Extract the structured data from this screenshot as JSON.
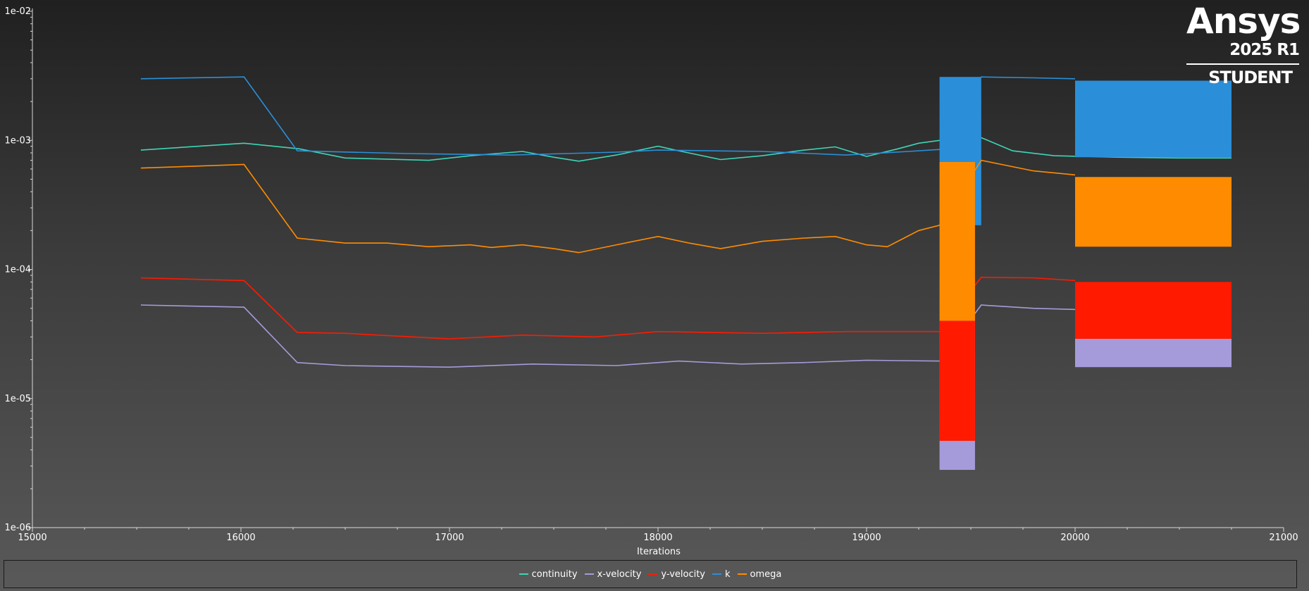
{
  "brand": {
    "name": "Ansys",
    "version": "2025 R1",
    "edition": "STUDENT"
  },
  "chart_data": {
    "type": "line",
    "title": "",
    "xlabel": "Iterations",
    "ylabel": "",
    "yscale": "log",
    "xlim": [
      15000,
      21000
    ],
    "ylim": [
      1e-06,
      0.01
    ],
    "x_ticks": [
      15000,
      16000,
      17000,
      18000,
      19000,
      20000,
      21000
    ],
    "y_ticks": [
      "1e-06",
      "1e-05",
      "1e-04",
      "1e-03",
      "1e-02"
    ],
    "grid": false,
    "legend_position": "bottom",
    "series": [
      {
        "name": "continuity",
        "color": "#3fd5b6",
        "points": [
          [
            15520,
            0.00084
          ],
          [
            16015,
            0.00095
          ],
          [
            16280,
            0.00086
          ],
          [
            16500,
            0.00073
          ],
          [
            16900,
            0.0007
          ],
          [
            17100,
            0.00076
          ],
          [
            17350,
            0.00082
          ],
          [
            17500,
            0.00074
          ],
          [
            17620,
            0.00069
          ],
          [
            17800,
            0.00077
          ],
          [
            18000,
            0.0009
          ],
          [
            18100,
            0.00083
          ],
          [
            18300,
            0.00071
          ],
          [
            18500,
            0.00076
          ],
          [
            18700,
            0.00084
          ],
          [
            18850,
            0.00089
          ],
          [
            19000,
            0.00075
          ],
          [
            19150,
            0.00086
          ],
          [
            19250,
            0.00095
          ],
          [
            19350,
            0.001
          ],
          [
            19450,
            0.00098
          ],
          [
            19550,
            0.00105
          ],
          [
            19700,
            0.00083
          ],
          [
            19900,
            0.00076
          ],
          [
            20200,
            0.00074
          ],
          [
            20500,
            0.00073
          ],
          [
            20750,
            0.00073
          ]
        ]
      },
      {
        "name": "x-velocity",
        "color": "#a59bda",
        "points": [
          [
            15520,
            5.3e-05
          ],
          [
            16015,
            5.1e-05
          ],
          [
            16270,
            1.9e-05
          ],
          [
            16500,
            1.8e-05
          ],
          [
            17000,
            1.75e-05
          ],
          [
            17400,
            1.85e-05
          ],
          [
            17800,
            1.8e-05
          ],
          [
            18100,
            1.95e-05
          ],
          [
            18400,
            1.85e-05
          ],
          [
            18700,
            1.9e-05
          ],
          [
            19000,
            1.98e-05
          ],
          [
            19350,
            1.95e-05
          ],
          [
            19550,
            5.3e-05
          ],
          [
            19800,
            5e-05
          ],
          [
            20000,
            4.9e-05
          ]
        ],
        "oscillation_bands": [
          {
            "x": [
              19350,
              19520
            ],
            "high": 4.5e-05,
            "low": 2.8e-06
          },
          {
            "x": [
              20000,
              20750
            ],
            "high": 3e-05,
            "low": 1.75e-05
          }
        ]
      },
      {
        "name": "y-velocity",
        "color": "#ff1a00",
        "points": [
          [
            15520,
            8.6e-05
          ],
          [
            16015,
            8.2e-05
          ],
          [
            16270,
            3.25e-05
          ],
          [
            16500,
            3.2e-05
          ],
          [
            17000,
            2.9e-05
          ],
          [
            17350,
            3.1e-05
          ],
          [
            17700,
            3e-05
          ],
          [
            18000,
            3.3e-05
          ],
          [
            18500,
            3.2e-05
          ],
          [
            18900,
            3.3e-05
          ],
          [
            19350,
            3.3e-05
          ],
          [
            19550,
            8.7e-05
          ],
          [
            19800,
            8.6e-05
          ],
          [
            20000,
            8.2e-05
          ]
        ],
        "oscillation_bands": [
          {
            "x": [
              19350,
              19520
            ],
            "high": 8.5e-05,
            "low": 4.7e-06
          },
          {
            "x": [
              20000,
              20750
            ],
            "high": 8e-05,
            "low": 2.9e-05
          }
        ]
      },
      {
        "name": "k",
        "color": "#2a8fd8",
        "points": [
          [
            15520,
            0.003
          ],
          [
            16015,
            0.0031
          ],
          [
            16270,
            0.00083
          ],
          [
            16800,
            0.00079
          ],
          [
            17300,
            0.00077
          ],
          [
            17800,
            0.00081
          ],
          [
            18000,
            0.00084
          ],
          [
            18500,
            0.00082
          ],
          [
            18900,
            0.00077
          ],
          [
            19200,
            0.00082
          ],
          [
            19350,
            0.00085
          ],
          [
            19550,
            0.0031
          ],
          [
            19800,
            0.00305
          ],
          [
            20000,
            0.003
          ]
        ],
        "oscillation_bands": [
          {
            "x": [
              19350,
              19550
            ],
            "high": 0.0031,
            "low": 0.00022
          },
          {
            "x": [
              20000,
              20750
            ],
            "high": 0.0029,
            "low": 0.00074
          }
        ]
      },
      {
        "name": "omega",
        "color": "#ff8c00",
        "points": [
          [
            15520,
            0.00061
          ],
          [
            16015,
            0.00065
          ],
          [
            16270,
            0.000175
          ],
          [
            16500,
            0.00016
          ],
          [
            16700,
            0.00016
          ],
          [
            16900,
            0.00015
          ],
          [
            17100,
            0.000155
          ],
          [
            17200,
            0.000148
          ],
          [
            17350,
            0.000155
          ],
          [
            17500,
            0.000145
          ],
          [
            17620,
            0.000135
          ],
          [
            17800,
            0.000155
          ],
          [
            18000,
            0.00018
          ],
          [
            18150,
            0.00016
          ],
          [
            18300,
            0.000145
          ],
          [
            18500,
            0.000165
          ],
          [
            18700,
            0.000175
          ],
          [
            18850,
            0.00018
          ],
          [
            19000,
            0.000155
          ],
          [
            19100,
            0.00015
          ],
          [
            19250,
            0.0002
          ],
          [
            19350,
            0.00022
          ],
          [
            19550,
            0.0007
          ],
          [
            19800,
            0.00058
          ],
          [
            20000,
            0.00054
          ]
        ],
        "oscillation_bands": [
          {
            "x": [
              19350,
              19520
            ],
            "high": 0.00068,
            "low": 4e-05
          },
          {
            "x": [
              20000,
              20750
            ],
            "high": 0.00052,
            "low": 0.00015
          }
        ]
      }
    ]
  }
}
